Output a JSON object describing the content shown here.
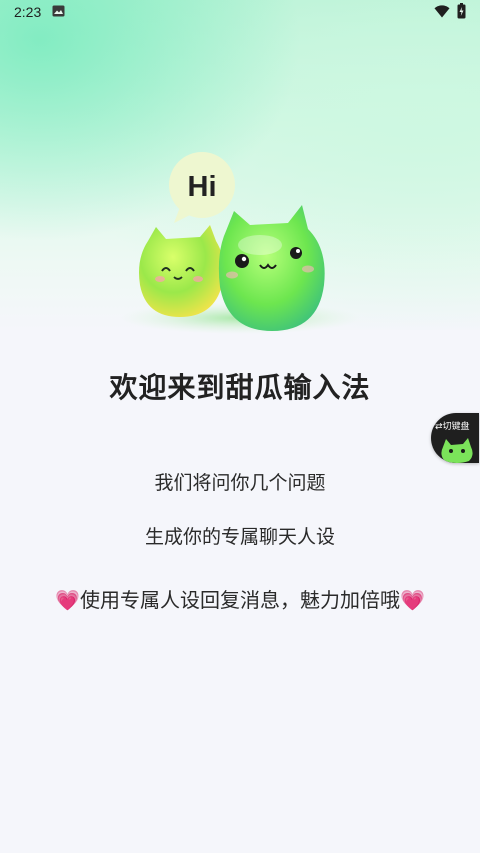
{
  "status_bar": {
    "time": "2:23",
    "icons": [
      "image-icon",
      "wifi-icon",
      "battery-icon"
    ]
  },
  "hero": {
    "bubble_text": "Hi",
    "accent_color": "#6cf06a"
  },
  "main": {
    "title": "欢迎来到甜瓜输入法",
    "line1": "我们将问你几个问题",
    "line2": "生成你的专属聊天人设",
    "line3_heart_left": "💗",
    "line3_text": "使用专属人设回复消息，魅力加倍哦",
    "line3_heart_right": "💗"
  },
  "floating_button": {
    "label": "切键盘"
  }
}
